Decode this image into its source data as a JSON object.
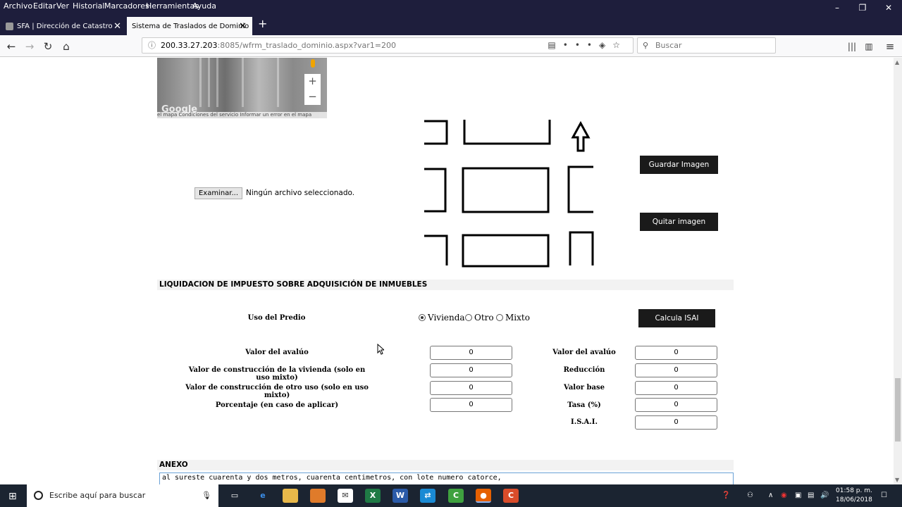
{
  "menubar": {
    "items": [
      "Archivo",
      "Editar",
      "Ver",
      "Historial",
      "Marcadores",
      "Herramientas",
      "Ayuda"
    ]
  },
  "tabs": [
    {
      "title": "SFA | Dirección de Catastro",
      "active": false
    },
    {
      "title": "Sistema de Traslados de Dominio",
      "active": true
    }
  ],
  "url": {
    "host": "200.33.27.203",
    "rest": ":8085/wfrm_traslado_dominio.aspx?var1=200"
  },
  "search": {
    "placeholder": "Buscar"
  },
  "map": {
    "brand": "Google",
    "footer": "el mapa   Condiciones del servicio   Informar un error en el mapa",
    "zoom_in": "+",
    "zoom_out": "−"
  },
  "file_input": {
    "button": "Examinar...",
    "status": "Ningún archivo seleccionado."
  },
  "buttons": {
    "save_image": "Guardar Imagen",
    "remove_image": "Quitar imagen",
    "calc_isai": "Calcula ISAI"
  },
  "section_title": "LIQUIDACION DE IMPUESTO SOBRE ADQUISICIÓN DE INMUEBLES",
  "uso_predio": {
    "label": "Uso del Predio",
    "options": [
      {
        "label": "Vivienda",
        "selected": true
      },
      {
        "label": "Otro",
        "selected": false
      },
      {
        "label": "Mixto",
        "selected": false
      }
    ]
  },
  "left_fields": [
    {
      "label": "Valor del avalúo",
      "value": "0"
    },
    {
      "label": "Valor de construcción de la vivienda (solo en uso mixto)",
      "value": "0"
    },
    {
      "label": "Valor de construcción de otro uso (solo en uso mixto)",
      "value": "0"
    },
    {
      "label": "Porcentaje (en caso de aplicar)",
      "value": "0"
    }
  ],
  "right_fields": [
    {
      "label": "Valor del avalúo",
      "value": "0"
    },
    {
      "label": "Reducción",
      "value": "0"
    },
    {
      "label": "Valor base",
      "value": "0"
    },
    {
      "label": "Tasa (%)",
      "value": "0"
    },
    {
      "label": "I.S.A.I.",
      "value": "0"
    }
  ],
  "annex": {
    "title": "ANEXO",
    "text": "al sureste cuarenta y dos metros, cuarenta centimetros, con lote numero catorce,"
  },
  "taskbar": {
    "search_placeholder": "Escribe aquí para buscar",
    "time": "01:58 p. m.",
    "date": "18/06/2018"
  }
}
